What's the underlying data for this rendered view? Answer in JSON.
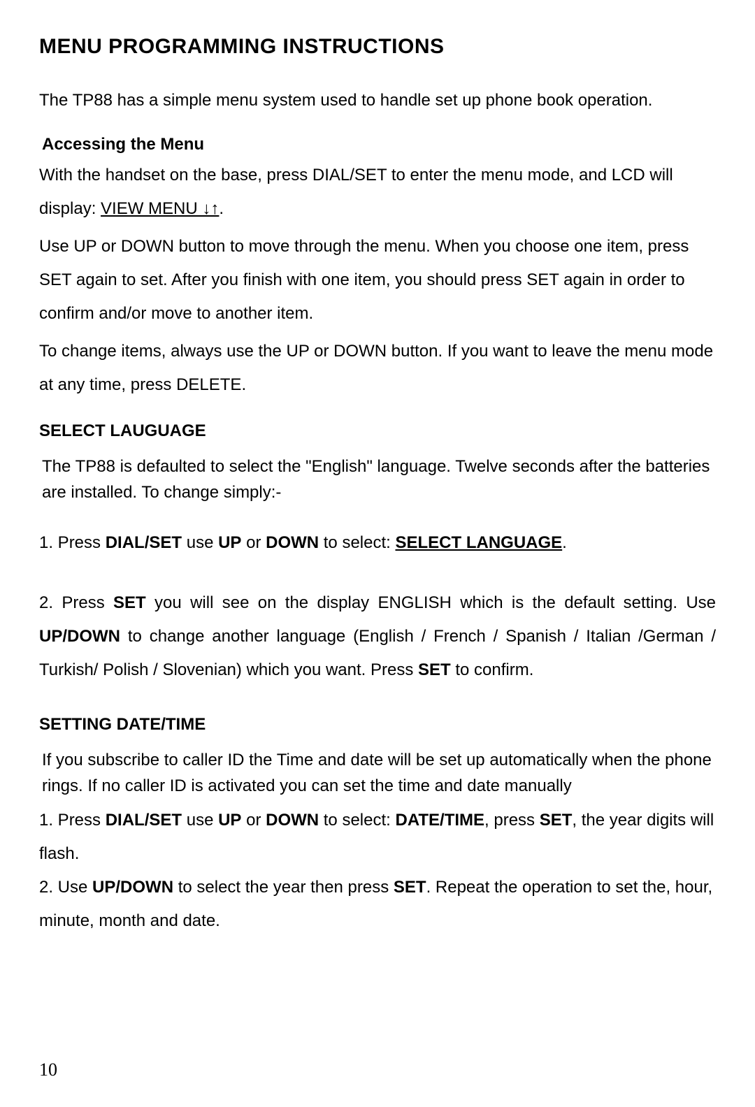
{
  "title": "MENU PROGRAMMING INSTRUCTIONS",
  "intro": "The TP88 has a simple menu system used to handle set up phone book operation.",
  "access": {
    "heading": "Accessing the Menu",
    "p1a": "With the handset on the base, press DIAL/SET to enter the menu mode, and LCD will display: ",
    "p1b": "VIEW MENU ↓↑",
    "p1c": ".",
    "p2": "Use UP or DOWN button to move through the menu. When you choose one item, press SET again to set.   After you finish with one item, you should press SET again in order to confirm and/or move to another item.",
    "p3": "To change items, always use the UP or DOWN button. If you want to leave the menu mode at any time, press DELETE."
  },
  "lang": {
    "heading": "SELECT LAUGUAGE",
    "p1": "The TP88 is defaulted to select the \"English\" language. Twelve seconds after the batteries are installed. To change simply:-",
    "step1_a": "1. Press ",
    "step1_b": "DIAL/SET",
    "step1_c": " use ",
    "step1_d": "UP",
    "step1_e": " or ",
    "step1_f": "DOWN",
    "step1_g": " to select: ",
    "step1_h": "SELECT LANGUAGE",
    "step1_i": ".",
    "step2_a": "2. Press ",
    "step2_b": "SET",
    "step2_c": " you will see on the display ENGLISH which is the default setting. Use ",
    "step2_d": "UP/DOWN",
    "step2_e": " to change another language (English / French / Spanish / Italian /German / Turkish/ Polish / Slovenian) which you want. Press ",
    "step2_f": "SET",
    "step2_g": " to confirm."
  },
  "dt": {
    "heading": "SETTING DATE/TIME",
    "p1": "If you subscribe to caller ID the Time and date will be set up automatically when the phone rings. If no caller ID is activated you can set the time and date manually",
    "step1_a": "1. Press ",
    "step1_b": "DIAL/SET",
    "step1_c": " use ",
    "step1_d": "UP",
    "step1_e": " or ",
    "step1_f": "DOWN",
    "step1_g": " to select: ",
    "step1_h": "DATE/TIME",
    "step1_i": ", press ",
    "step1_j": "SET",
    "step1_k": ", the year digits will flash.",
    "step2_a": "2. Use ",
    "step2_b": "UP/DOWN",
    "step2_c": " to select the year then press ",
    "step2_d": "SET",
    "step2_e": ". Repeat the operation to set the, hour, minute, month and date."
  },
  "page_number": "10"
}
